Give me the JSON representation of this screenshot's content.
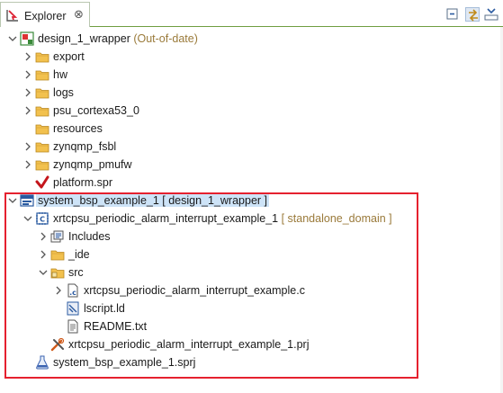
{
  "view": {
    "tab_label": "Explorer",
    "close_glyph": "⊗"
  },
  "toolbar": [
    {
      "name": "collapse-all-icon",
      "active": false
    },
    {
      "name": "link-with-editor-icon",
      "active": true
    },
    {
      "name": "view-menu-icon",
      "active": false
    }
  ],
  "tree": [
    {
      "depth": 0,
      "twisty": "expanded",
      "icon": "platform-project-icon",
      "label": "design_1_wrapper",
      "decoration": " (Out-of-date)"
    },
    {
      "depth": 1,
      "twisty": "collapsed",
      "icon": "folder-icon",
      "label": "export"
    },
    {
      "depth": 1,
      "twisty": "collapsed",
      "icon": "folder-icon",
      "label": "hw"
    },
    {
      "depth": 1,
      "twisty": "collapsed",
      "icon": "folder-icon",
      "label": "logs"
    },
    {
      "depth": 1,
      "twisty": "collapsed",
      "icon": "folder-icon",
      "label": "psu_cortexa53_0"
    },
    {
      "depth": 1,
      "twisty": "none",
      "icon": "folder-icon",
      "label": "resources"
    },
    {
      "depth": 1,
      "twisty": "collapsed",
      "icon": "folder-icon",
      "label": "zynqmp_fsbl"
    },
    {
      "depth": 1,
      "twisty": "collapsed",
      "icon": "folder-icon",
      "label": "zynqmp_pmufw"
    },
    {
      "depth": 1,
      "twisty": "none",
      "icon": "platform-spr-icon",
      "label": "platform.spr"
    },
    {
      "depth": 0,
      "twisty": "expanded",
      "icon": "system-project-icon",
      "label": "system_bsp_example_1",
      "label_suffix": " [ design_1_wrapper ]",
      "selected": true
    },
    {
      "depth": 1,
      "twisty": "expanded",
      "icon": "application-project-icon",
      "label": "xrtcpsu_periodic_alarm_interrupt_example_1",
      "decoration": " [ standalone_domain ]"
    },
    {
      "depth": 2,
      "twisty": "collapsed",
      "icon": "includes-icon",
      "label": "Includes"
    },
    {
      "depth": 2,
      "twisty": "collapsed",
      "icon": "folder-icon",
      "label": "_ide"
    },
    {
      "depth": 2,
      "twisty": "expanded",
      "icon": "source-folder-icon",
      "label": "src"
    },
    {
      "depth": 3,
      "twisty": "collapsed",
      "icon": "c-file-icon",
      "label": "xrtcpsu_periodic_alarm_interrupt_example.c"
    },
    {
      "depth": 3,
      "twisty": "none",
      "icon": "linker-script-icon",
      "label": "lscript.ld"
    },
    {
      "depth": 3,
      "twisty": "none",
      "icon": "text-file-icon",
      "label": "README.txt"
    },
    {
      "depth": 2,
      "twisty": "none",
      "icon": "prj-file-icon",
      "label": "xrtcpsu_periodic_alarm_interrupt_example_1.prj"
    },
    {
      "depth": 1,
      "twisty": "none",
      "icon": "sprj-file-icon",
      "label": "system_bsp_example_1.sprj"
    }
  ],
  "colors": {
    "decoration": "#9a7a3a",
    "selection": "#cde3f7",
    "highlight_box": "#e5212f",
    "folder": "#f2c14e"
  }
}
